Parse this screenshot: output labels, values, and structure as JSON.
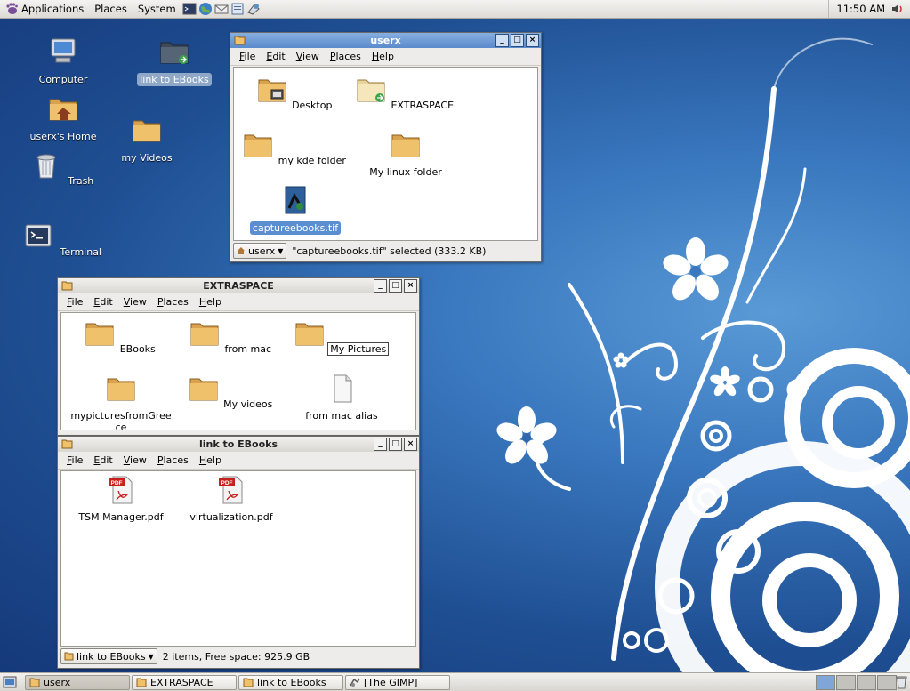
{
  "top_panel": {
    "menus": [
      "Applications",
      "Places",
      "System"
    ],
    "launchers": [
      "terminal-icon",
      "browser-icon",
      "mail-icon",
      "editor-icon",
      "notes-icon"
    ],
    "clock": "11:50 AM"
  },
  "desktop_icons": [
    {
      "label": "Computer",
      "icon": "computer-icon"
    },
    {
      "label": "link to EBooks",
      "icon": "folder-link-icon"
    },
    {
      "label": "userx's Home",
      "icon": "home-folder-icon"
    },
    {
      "label": "my Videos",
      "icon": "folder-icon"
    },
    {
      "label": "Trash",
      "icon": "trash-icon"
    },
    {
      "label": "Terminal",
      "icon": "terminal-icon"
    }
  ],
  "windows": {
    "userx": {
      "title": "userx",
      "menu": [
        "File",
        "Edit",
        "View",
        "Places",
        "Help"
      ],
      "items": [
        {
          "label": "Desktop"
        },
        {
          "label": "EXTRASPACE"
        },
        {
          "label": "my kde folder"
        },
        {
          "label": "My linux folder"
        },
        {
          "label": "captureebooks.tif"
        }
      ],
      "location": "userx",
      "status": "\"captureebooks.tif\" selected (333.2 KB)"
    },
    "extraspace": {
      "title": "EXTRASPACE",
      "menu": [
        "File",
        "Edit",
        "View",
        "Places",
        "Help"
      ],
      "items": [
        {
          "label": "EBooks"
        },
        {
          "label": "from mac"
        },
        {
          "label": "My Pictures"
        },
        {
          "label": "mypicturesfromGree"
        },
        {
          "label": "ce"
        },
        {
          "label": "My videos"
        },
        {
          "label": "from mac alias"
        }
      ]
    },
    "ebooks": {
      "title": "link to EBooks",
      "menu": [
        "File",
        "Edit",
        "View",
        "Places",
        "Help"
      ],
      "items": [
        {
          "label": "TSM Manager.pdf",
          "badge": "PDF"
        },
        {
          "label": "virtualization.pdf",
          "badge": "PDF"
        }
      ],
      "location": "link to EBooks",
      "status": "2 items, Free space: 925.9 GB"
    }
  },
  "taskbar": [
    {
      "label": "userx"
    },
    {
      "label": "EXTRASPACE"
    },
    {
      "label": "link to EBooks"
    },
    {
      "label": "[The GIMP]"
    }
  ]
}
